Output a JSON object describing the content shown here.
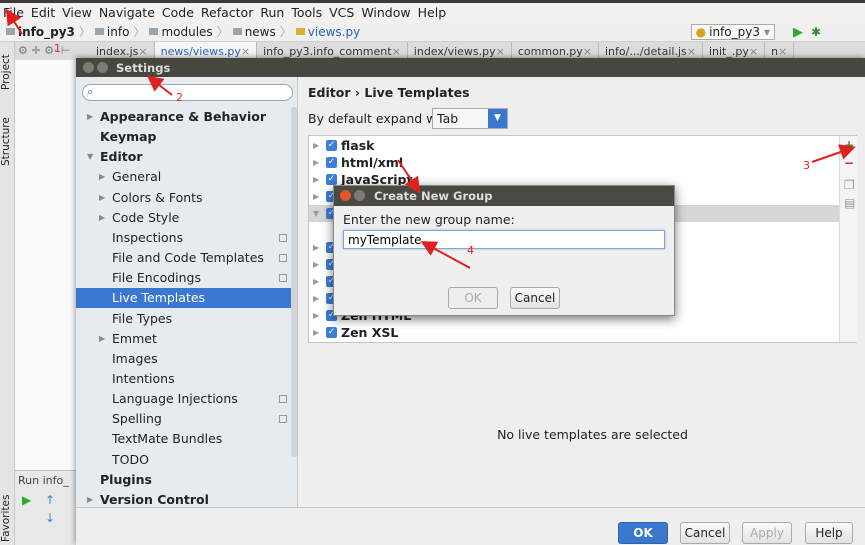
{
  "menu": [
    "File",
    "Edit",
    "View",
    "Navigate",
    "Code",
    "Refactor",
    "Run",
    "Tools",
    "VCS",
    "Window",
    "Help"
  ],
  "breadcrumb": [
    "info_py3",
    "info",
    "modules",
    "news",
    "views.py"
  ],
  "run_config": "info_py3",
  "editor_tabs": [
    {
      "label": "index.js",
      "active": false
    },
    {
      "label": "news/views.py",
      "active": true
    },
    {
      "label": "info_py3.info_comment",
      "active": false
    },
    {
      "label": "index/views.py",
      "active": false
    },
    {
      "label": "common.py",
      "active": false
    },
    {
      "label": "info/.../detail.js",
      "active": false
    },
    {
      "label": "init_.py",
      "active": false
    },
    {
      "label": "n",
      "active": false
    }
  ],
  "side_tabs": {
    "project": "Project",
    "structure": "Structure",
    "favorites": "Favorites"
  },
  "run_panel": {
    "label": "Run",
    "config": "info_"
  },
  "settings": {
    "title": "Settings",
    "search_value": "",
    "nav": [
      {
        "label": "Appearance & Behavior",
        "level": 0,
        "bold": true,
        "arrow": "collapsed"
      },
      {
        "label": "Keymap",
        "level": 0,
        "bold": true
      },
      {
        "label": "Editor",
        "level": 0,
        "bold": true,
        "arrow": "expanded"
      },
      {
        "label": "General",
        "level": 1,
        "arrow": "collapsed"
      },
      {
        "label": "Colors & Fonts",
        "level": 1,
        "arrow": "collapsed"
      },
      {
        "label": "Code Style",
        "level": 1,
        "arrow": "collapsed"
      },
      {
        "label": "Inspections",
        "level": 1,
        "icon": true
      },
      {
        "label": "File and Code Templates",
        "level": 1,
        "icon": true
      },
      {
        "label": "File Encodings",
        "level": 1,
        "icon": true
      },
      {
        "label": "Live Templates",
        "level": 1,
        "selected": true
      },
      {
        "label": "File Types",
        "level": 1
      },
      {
        "label": "Emmet",
        "level": 1,
        "arrow": "collapsed"
      },
      {
        "label": "Images",
        "level": 1
      },
      {
        "label": "Intentions",
        "level": 1
      },
      {
        "label": "Language Injections",
        "level": 1,
        "icon": true
      },
      {
        "label": "Spelling",
        "level": 1,
        "icon": true
      },
      {
        "label": "TextMate Bundles",
        "level": 1
      },
      {
        "label": "TODO",
        "level": 1
      },
      {
        "label": "Plugins",
        "level": 0,
        "bold": true
      },
      {
        "label": "Version Control",
        "level": 0,
        "bold": true,
        "arrow": "collapsed"
      }
    ],
    "breadcrumb": "Editor › Live Templates",
    "expand_label": "By default expand with",
    "expand_value": "Tab",
    "template_groups": [
      "flask",
      "html/xml",
      "JavaScript",
      "",
      "",
      "",
      "",
      "",
      "",
      "",
      "Zen HTML",
      "Zen XSL"
    ],
    "empty_message": "No live templates are selected",
    "buttons": {
      "ok": "OK",
      "cancel": "Cancel",
      "apply": "Apply",
      "help": "Help"
    },
    "accent": "#3a78d0"
  },
  "new_group_dialog": {
    "title": "Create New Group",
    "prompt": "Enter the new group name:",
    "value": "myTemplate",
    "ok": "OK",
    "cancel": "Cancel"
  },
  "annotations": [
    "1",
    "2",
    "3",
    "4"
  ],
  "annotation_color": "#e02020"
}
